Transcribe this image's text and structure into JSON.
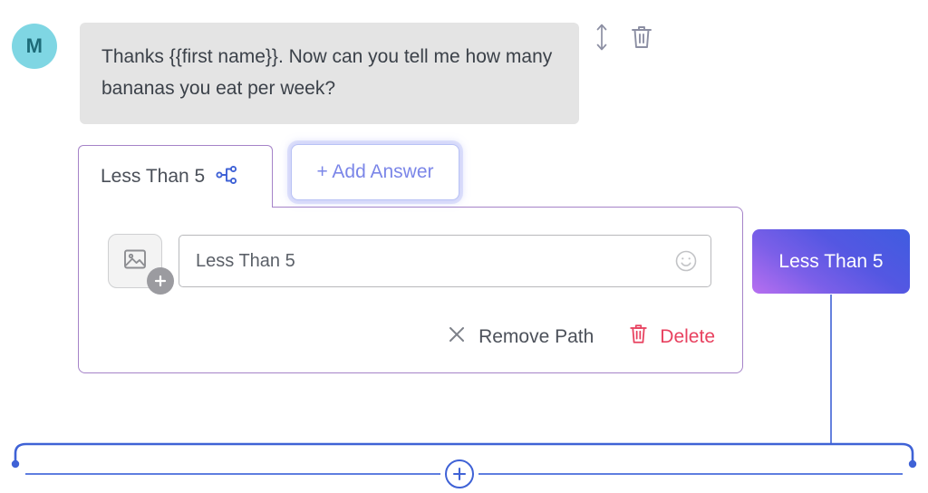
{
  "avatar": {
    "initial": "M",
    "bg_color": "#7fd6e3",
    "text_color": "#1d6b78"
  },
  "message": {
    "text": "Thanks {{first name}}. Now can you tell me how many bananas you eat per week?",
    "bg_color": "#e4e4e4"
  },
  "header_tools": {
    "reorder_icon": "vertical-resize-icon",
    "delete_icon": "trash-icon"
  },
  "tabs": [
    {
      "label": "Less Than 5",
      "icon": "branch-icon",
      "active": true
    }
  ],
  "add_answer": {
    "label": "+ Add Answer",
    "color": "#7b86e8"
  },
  "answer_panel": {
    "border_color": "#a583c8",
    "image_button": {
      "icon": "image-icon",
      "badge_icon": "plus-icon"
    },
    "input": {
      "value": "Less Than 5",
      "placeholder": "Answer text",
      "emoji_icon": "smiley-icon"
    },
    "actions": [
      {
        "label": "Remove Path",
        "icon": "close-x-icon",
        "color": "#4c515a"
      },
      {
        "label": "Delete",
        "icon": "trash-icon",
        "color": "#e8415f"
      }
    ]
  },
  "node_card": {
    "label": "Less Than 5",
    "gradient_from": "#3f5ce0",
    "gradient_to": "#b86ff0"
  },
  "flow_connector": {
    "add_step_icon": "plus-circle-icon",
    "line_color": "#3f62d6"
  }
}
